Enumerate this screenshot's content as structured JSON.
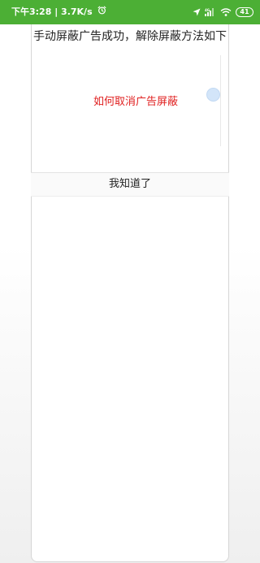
{
  "status_bar": {
    "time_speed": "下午3:28 | 3.7K/s",
    "icons": [
      "alarm-clock-icon",
      "location-arrow-icon",
      "cellular-signal-icon",
      "wifi-icon",
      "battery-icon"
    ],
    "battery_level": "41",
    "background_color": "#4caf35"
  },
  "dialog": {
    "title": "手动屏蔽广告成功，解除屏蔽方法如下",
    "guide_link": "如何取消广告屏蔽",
    "link_color": "#e02020",
    "confirm_button": "我知道了"
  }
}
